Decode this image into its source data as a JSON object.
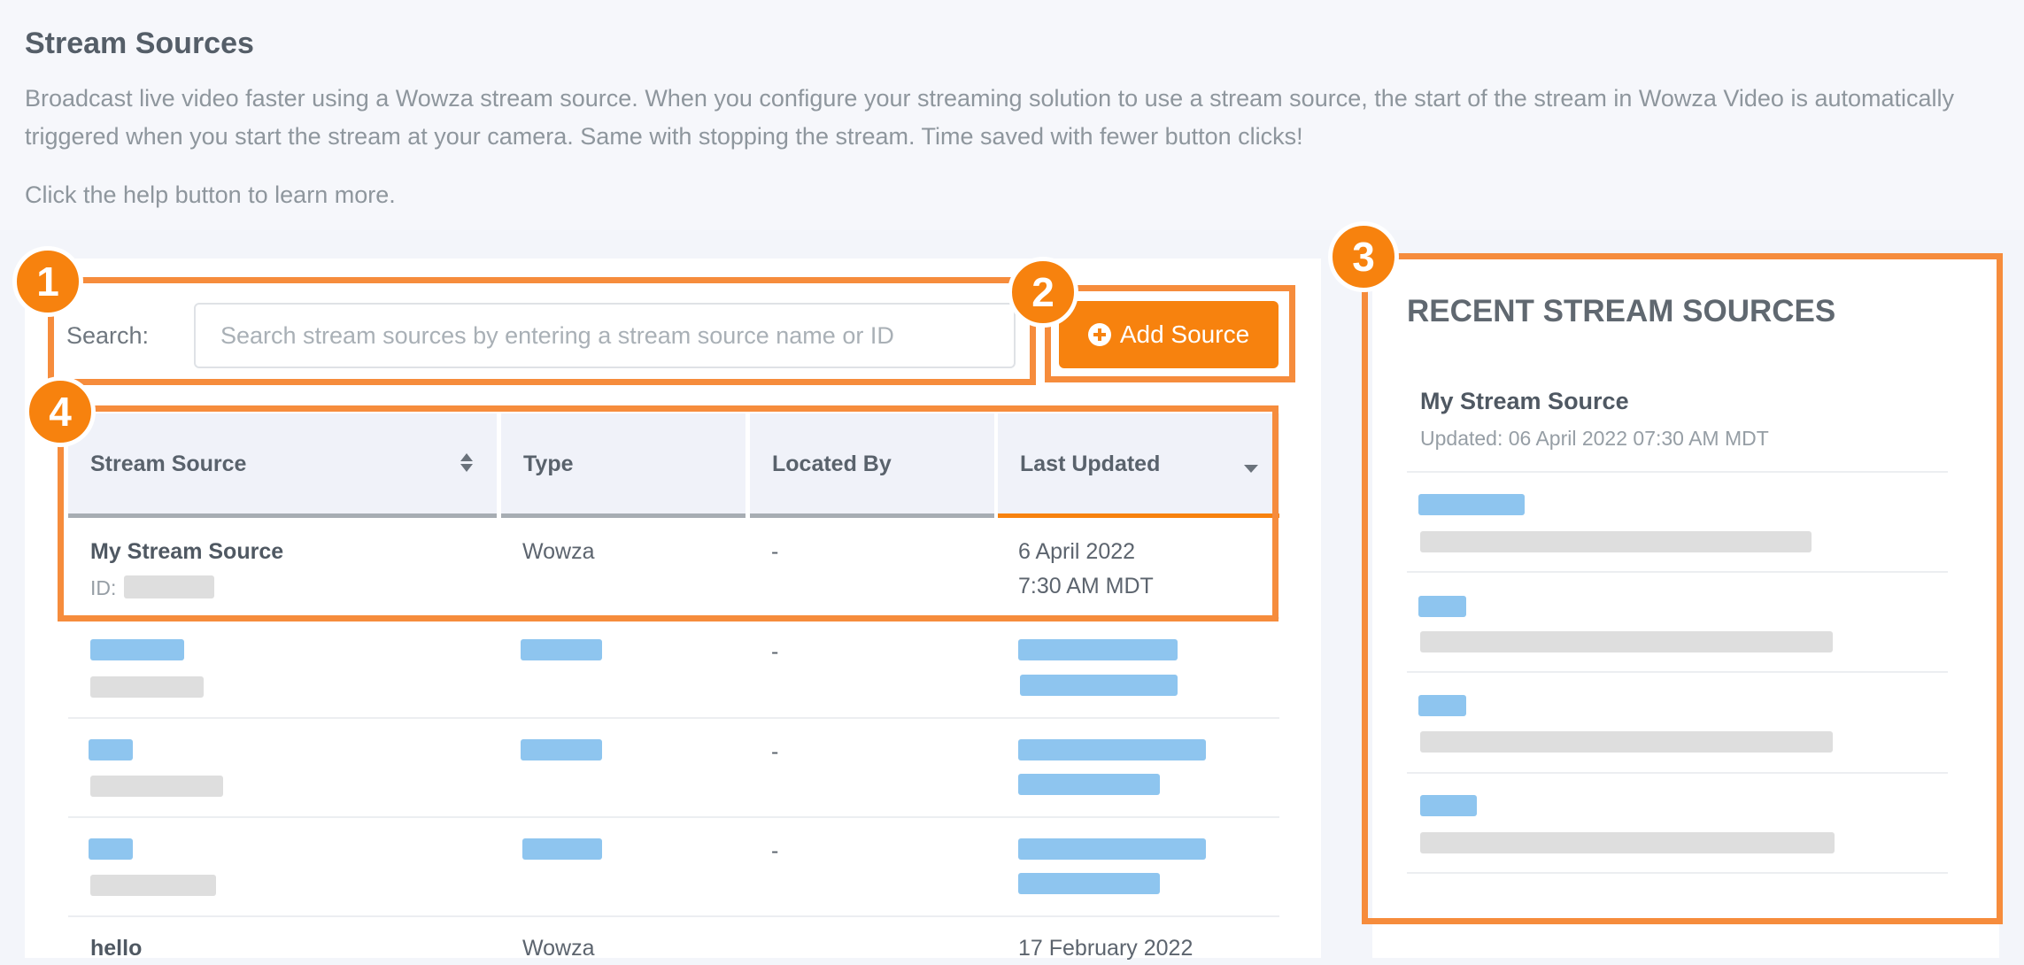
{
  "page": {
    "title": "Stream Sources",
    "description": "Broadcast live video faster using a Wowza stream source. When you configure your streaming solution to use a stream source, the start of the stream in Wowza Video is automatically triggered when you start the stream at your camera. Same with stopping the stream. Time saved with fewer button clicks!",
    "help_text": "Click the help button to learn more."
  },
  "search": {
    "label": "Search:",
    "placeholder": "Search stream sources by entering a stream source name or ID"
  },
  "toolbar": {
    "add_label": "Add Source",
    "add_icon": "plus-circle-icon"
  },
  "table": {
    "columns": [
      "Stream Source",
      "Type",
      "Located By",
      "Last Updated"
    ],
    "rows": [
      {
        "name": "My Stream Source",
        "id_label": "ID:",
        "type": "Wowza",
        "located_by": "-",
        "updated_date": "6 April 2022",
        "updated_time": "7:30 AM MDT"
      },
      {
        "located_by": "-"
      },
      {
        "located_by": "-"
      },
      {
        "located_by": "-"
      },
      {
        "name": "hello",
        "type": "Wowza",
        "updated_date": "17 February 2022"
      }
    ]
  },
  "recent": {
    "title": "RECENT STREAM SOURCES",
    "items": [
      {
        "name": "My Stream Source",
        "updated": "Updated: 06 April 2022 07:30 AM MDT"
      }
    ]
  },
  "callouts": [
    "1",
    "2",
    "3",
    "4"
  ],
  "colors": {
    "accent": "#f7820e",
    "callout_border": "#f68c3c",
    "redaction_blue": "#8ec5ef",
    "redaction_gray": "#dedede"
  }
}
